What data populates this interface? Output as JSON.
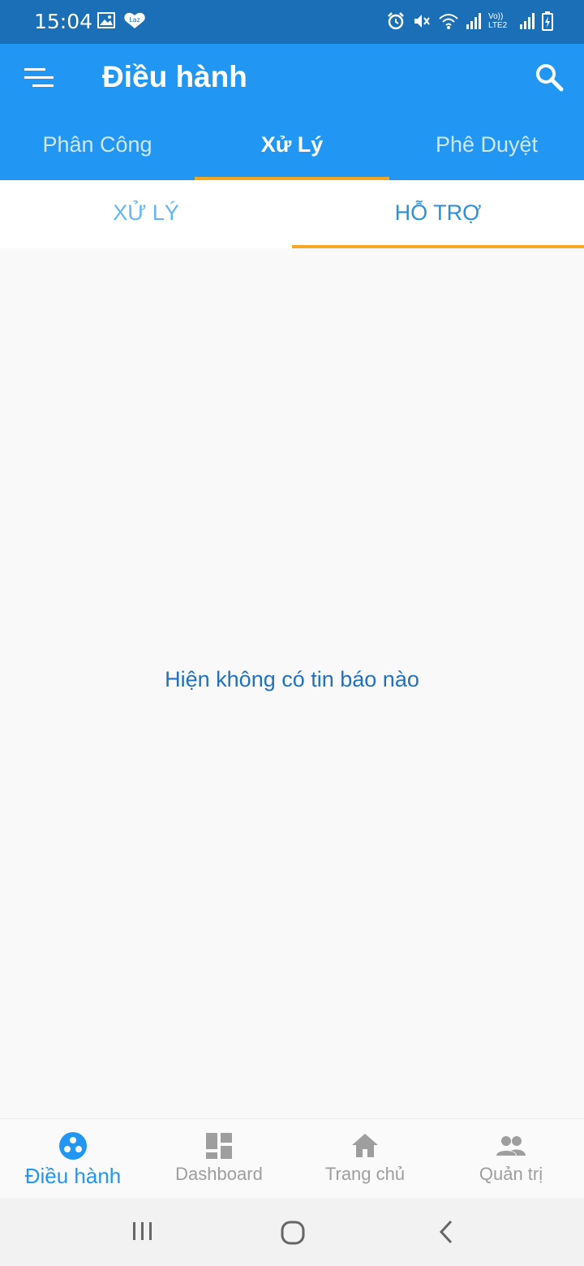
{
  "status_bar": {
    "time": "15:04",
    "left_icons": [
      "image-icon",
      "lazada-icon"
    ],
    "right_icons": [
      "alarm-icon",
      "mute-icon",
      "wifi-icon",
      "signal-icon",
      "volte-icon",
      "signal-icon",
      "battery-icon"
    ],
    "volte_label": "Vo)) LTE2"
  },
  "app_bar": {
    "title": "Điều hành",
    "menu_icon": "menu-icon",
    "search_icon": "search-icon"
  },
  "top_tabs": [
    {
      "label": "Phân Công",
      "active": false
    },
    {
      "label": "Xử Lý",
      "active": true
    },
    {
      "label": "Phê Duyệt",
      "active": false
    }
  ],
  "sub_tabs": [
    {
      "label": "XỬ LÝ",
      "active": false
    },
    {
      "label": "HỖ TRỢ",
      "active": true
    }
  ],
  "content": {
    "empty_message": "Hiện không có tin báo nào"
  },
  "bottom_nav": [
    {
      "label": "Điều hành",
      "icon": "operations-icon",
      "active": true
    },
    {
      "label": "Dashboard",
      "icon": "dashboard-icon",
      "active": false
    },
    {
      "label": "Trang chủ",
      "icon": "home-icon",
      "active": false
    },
    {
      "label": "Quản trị",
      "icon": "people-icon",
      "active": false
    }
  ],
  "colors": {
    "primary": "#2196f3",
    "status_bar": "#1a6fb7",
    "accent": "#f5a623",
    "inactive": "#9e9e9e"
  }
}
